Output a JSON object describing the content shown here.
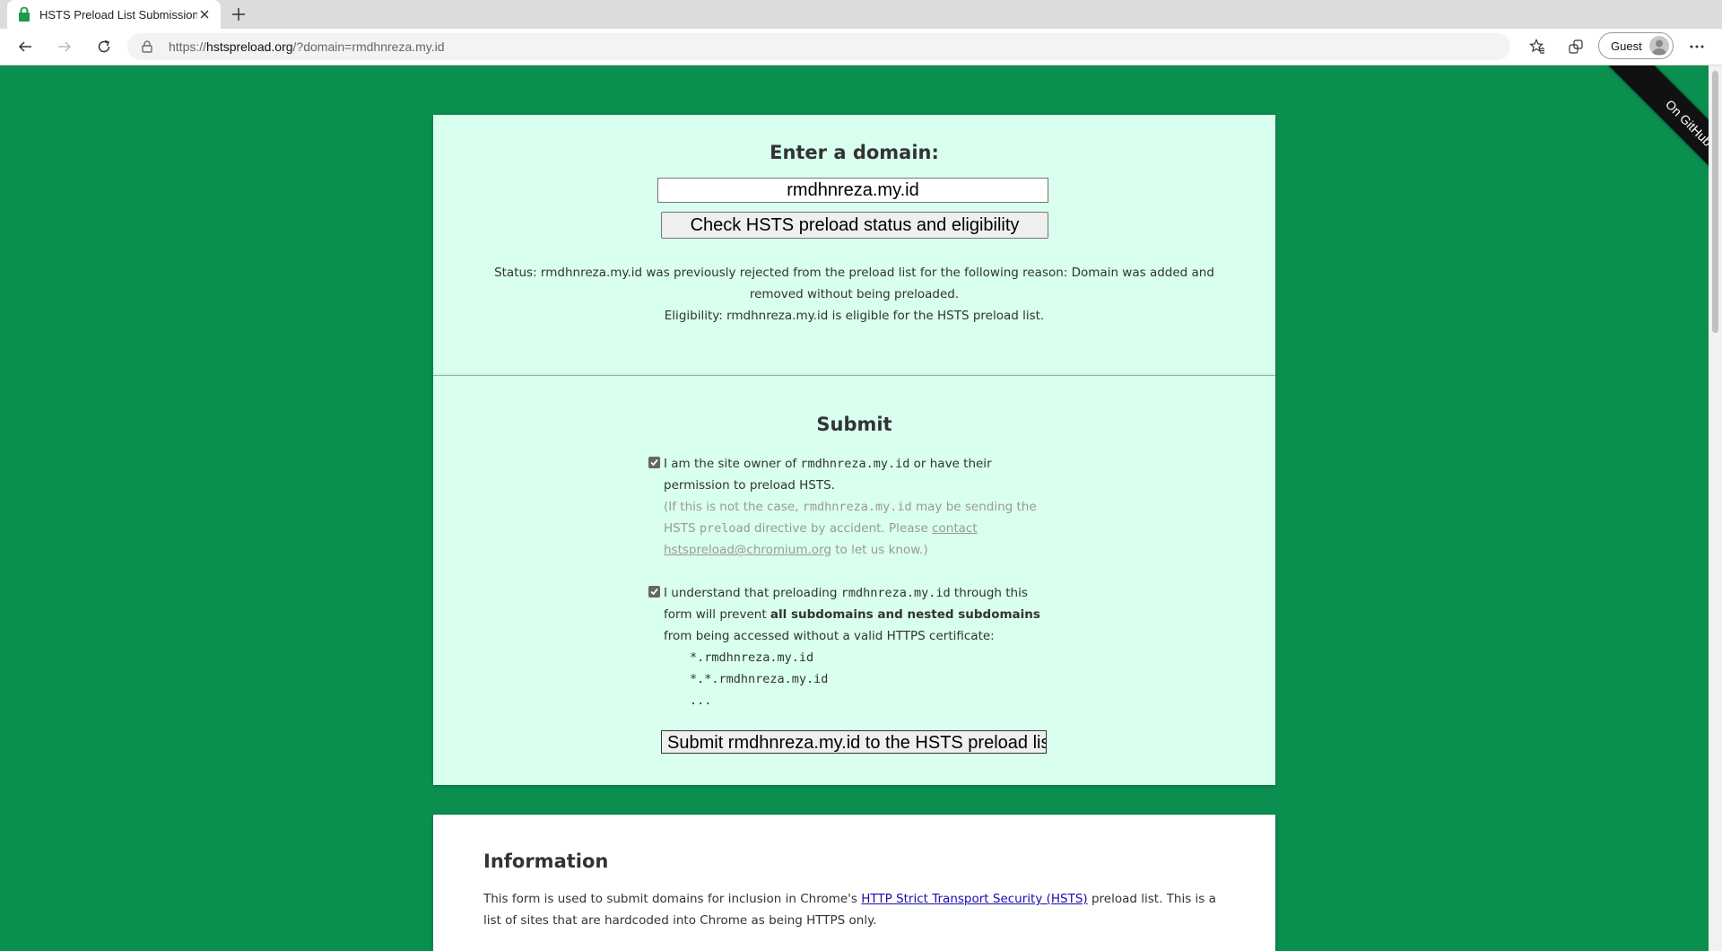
{
  "browser": {
    "tab_title": "HSTS Preload List Submission",
    "url_host": "hstspreload.org",
    "url_rest": "/?domain=rmdhnreza.my.id",
    "url_scheme": "https://",
    "profile_label": "Guest"
  },
  "ribbon": {
    "label": "On GitHub"
  },
  "check": {
    "heading": "Enter a domain:",
    "domain_value": "rmdhnreza.my.id",
    "button_label": "Check HSTS preload status and eligibility",
    "status_line": "Status: rmdhnreza.my.id was previously rejected from the preload list for the following reason: Domain was added and removed without being preloaded.",
    "eligibility_line": "Eligibility: rmdhnreza.my.id is eligible for the HSTS preload list."
  },
  "submit": {
    "heading": "Submit",
    "owner_text_1": "I am the site owner of",
    "domain": "rmdhnreza.my.id",
    "owner_text_2": "or have their permission to preload HSTS.",
    "note_1": "(If this is not the case,",
    "note_2": "may be sending the HSTS",
    "note_preload": "preload",
    "note_3": "directive by accident. Please",
    "note_link": "contact hstspreload@chromium.org",
    "note_4": "to let us know.)",
    "understand_1": "I understand that preloading",
    "understand_2": "through this form will prevent",
    "understand_bold": "all subdomains and nested subdomains",
    "understand_3": "from being accessed without a valid HTTPS certificate:",
    "code_lines": [
      "*.rmdhnreza.my.id",
      "*.*.rmdhnreza.my.id",
      "..."
    ],
    "button_label": "Submit rmdhnreza.my.id to the HSTS preload list"
  },
  "info": {
    "heading": "Information",
    "text_1": "This form is used to submit domains for inclusion in Chrome's",
    "link": "HTTP Strict Transport Security (HSTS)",
    "text_2": "preload list. This is a list of sites that are hardcoded into Chrome as being HTTPS only."
  },
  "colors": {
    "page_bg": "#0b8f4f",
    "card_bg": "#d9ffee"
  }
}
